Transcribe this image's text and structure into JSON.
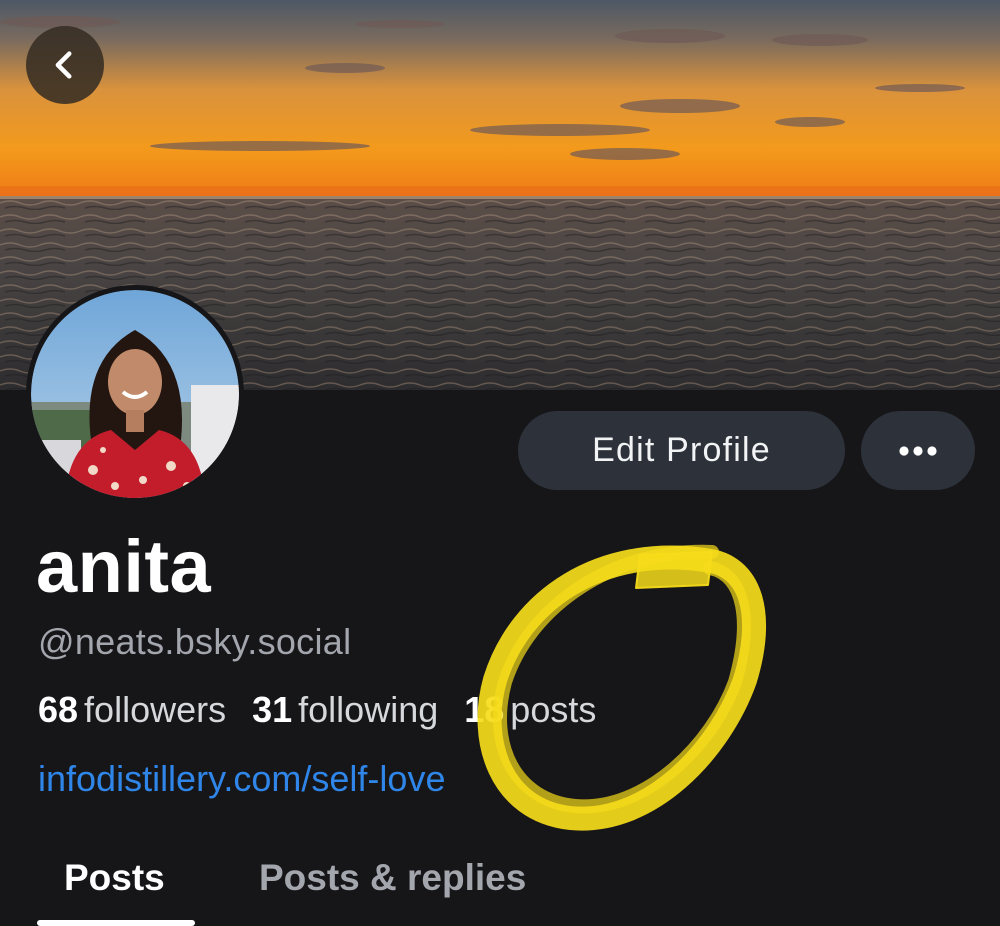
{
  "header": {
    "back_icon": "chevron-left-icon"
  },
  "profile": {
    "display_name": "anita",
    "handle": "@neats.bsky.social",
    "stats": {
      "followers_count": "68",
      "followers_label": "followers",
      "following_count": "31",
      "following_label": "following",
      "posts_count": "18",
      "posts_label": "posts"
    },
    "link": "infodistillery.com/self-love"
  },
  "actions": {
    "edit_label": "Edit Profile",
    "more_icon": "more-horizontal-icon"
  },
  "tabs": [
    {
      "label": "Posts",
      "active": true
    },
    {
      "label": "Posts & replies",
      "active": false
    }
  ],
  "colors": {
    "background": "#161619",
    "button_bg": "#2c313a",
    "link": "#2f86e8",
    "highlight": "#f6dc1a"
  }
}
